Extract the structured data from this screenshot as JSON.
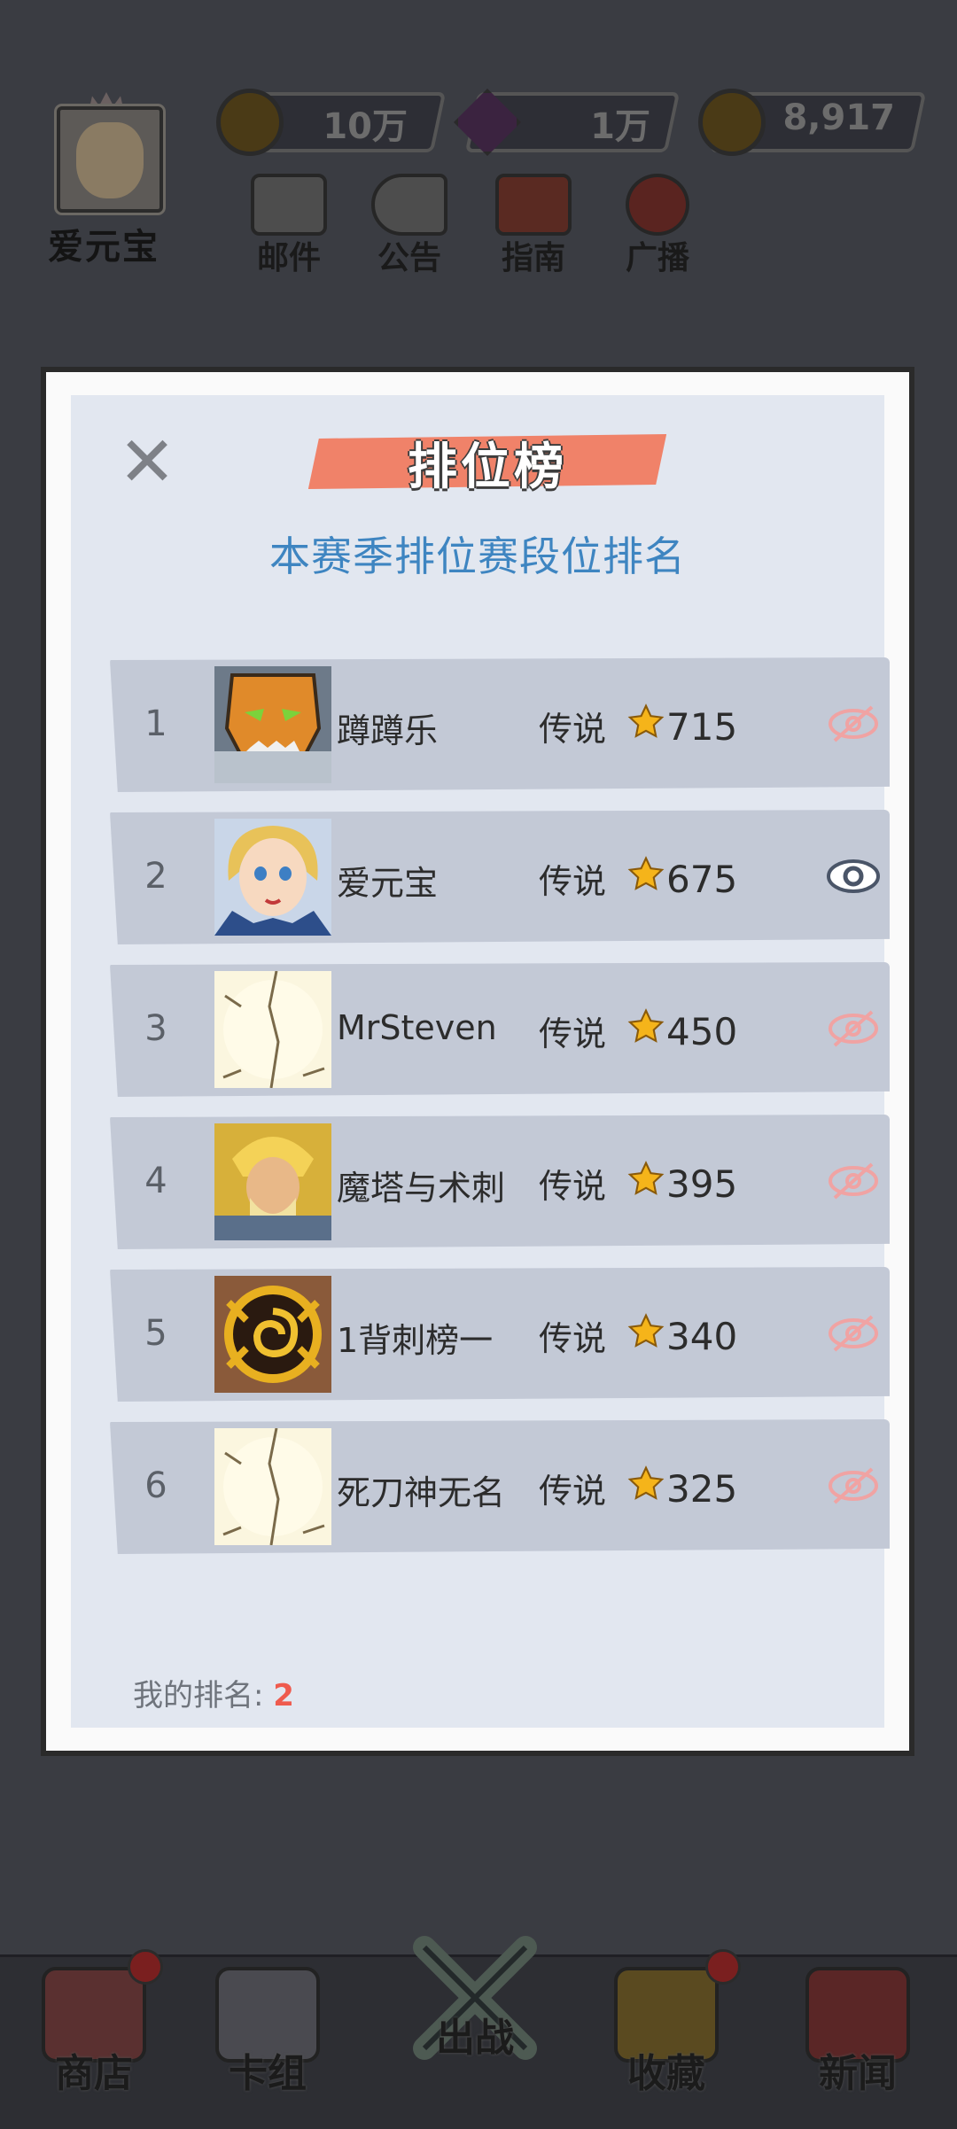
{
  "hud": {
    "player_name": "爱元宝",
    "resources": [
      {
        "name": "gold-coin",
        "value": "10万",
        "color": "#c49a2a"
      },
      {
        "name": "purple-gem",
        "value": "1万",
        "color": "#8e3aa8"
      },
      {
        "name": "star-coin",
        "value": "8,917",
        "color": "#c49a2a"
      }
    ],
    "buttons": [
      {
        "label": "邮件",
        "icon": "mail-icon"
      },
      {
        "label": "公告",
        "icon": "megaphone-icon"
      },
      {
        "label": "指南",
        "icon": "book-icon"
      },
      {
        "label": "广播",
        "icon": "broadcast-icon"
      }
    ]
  },
  "dialog": {
    "title": "排位榜",
    "subtitle": "本赛季排位赛段位排名",
    "close_icon": "close-icon",
    "rows": [
      {
        "rank": "1",
        "name": "蹲蹲乐",
        "tier": "传说",
        "score": "715",
        "avatar": "orange-mask-avatar",
        "visible": false
      },
      {
        "rank": "2",
        "name": "爱元宝",
        "tier": "传说",
        "score": "675",
        "avatar": "blonde-girl-avatar",
        "visible": true
      },
      {
        "rank": "3",
        "name": "MrSteven",
        "tier": "传说",
        "score": "450",
        "avatar": "cracked-egg-avatar",
        "visible": false
      },
      {
        "rank": "4",
        "name": "魔塔与术刺",
        "tier": "传说",
        "score": "395",
        "avatar": "golden-warrior-avatar",
        "visible": false
      },
      {
        "rank": "5",
        "name": "1背刺榜一",
        "tier": "传说",
        "score": "340",
        "avatar": "spiral-emblem-avatar",
        "visible": false
      },
      {
        "rank": "6",
        "name": "死刀神无名",
        "tier": "传说",
        "score": "325",
        "avatar": "cracked-egg-avatar",
        "visible": false
      }
    ],
    "my_rank_label": "我的排名:",
    "my_rank_value": "2"
  },
  "nav": [
    {
      "label": "商店",
      "icon": "shop-icon",
      "badge": true
    },
    {
      "label": "卡组",
      "icon": "cards-icon",
      "badge": false
    },
    {
      "label": "出战",
      "icon": "crossed-swords-icon",
      "badge": false
    },
    {
      "label": "收藏",
      "icon": "collection-icon",
      "badge": true
    },
    {
      "label": "新闻",
      "icon": "news-tv-icon",
      "badge": false
    }
  ],
  "colors": {
    "title_ribbon": "#f08269",
    "subtitle": "#3e85c1",
    "hidden_eye": "#f0a3a3",
    "visible_eye": "#4a5568",
    "my_rank_value": "#ef5b4e"
  }
}
